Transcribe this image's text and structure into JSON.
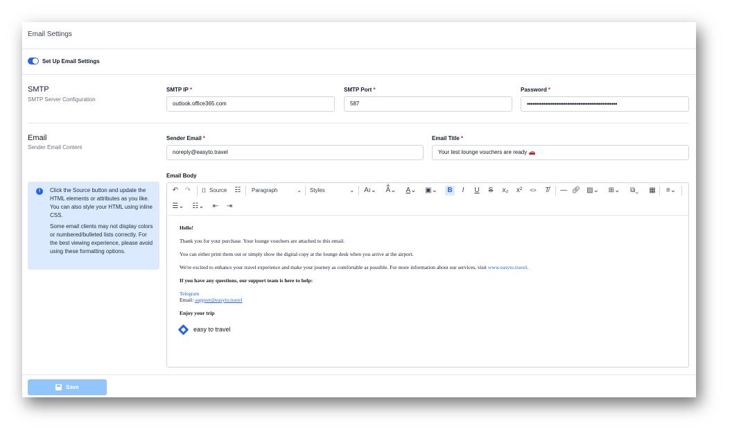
{
  "page": {
    "title": "Email Settings"
  },
  "toggle": {
    "label": "Set Up Email Settings",
    "enabled": true,
    "accent": "#2563eb"
  },
  "smtp": {
    "title": "SMTP",
    "subtitle": "SMTP Server Configuration",
    "ip_label": "SMTP IP",
    "ip_value": "outlook.office365.com",
    "port_label": "SMTP Port",
    "port_value": "587",
    "password_label": "Password",
    "password_value": "•••••••••••••••••••••••••••••••••••••••••••••••••"
  },
  "email": {
    "title": "Email",
    "subtitle": "Sender Email Content",
    "sender_label": "Sender Email",
    "sender_value": "noreply@easyto.travel",
    "title_label": "Email Title",
    "title_value": "Your test lounge vouchers are ready 🚗",
    "body_label": "Email Body"
  },
  "required_mark": "*",
  "info": {
    "icon": "!",
    "paragraph1": "Click the Source button and update the HTML elements or attributes as you like. You can also style your HTML using inline CSS.",
    "paragraph2": "Some email clients may not display colors or numbered/bulleted lists correctly. For the best viewing experience, please avoid using these formatting options."
  },
  "toolbar": {
    "source_label": "Source",
    "paragraph_label": "Paragraph",
    "styles_label": "Styles"
  },
  "body": {
    "greeting": "Hello!",
    "line1": "Thank you for your purchase. Your lounge vouchers are attached to this email.",
    "line2": "You can either print them out or simply show the digital copy at the lounge desk when you arrive at the airport.",
    "line3_text": "We're excited to enhance your travel experience and make your journey as comfortable as possible. For more information about our services, visit ",
    "line3_link": "www.easyto.travel",
    "line3_end": ".",
    "questions": "If you have any questions, our support team is here to help:",
    "telegram": "Telegram",
    "email_prefix": "Email: ",
    "email_link": "support@easyto.travel",
    "signoff": "Enjoy your trip",
    "logo_text": "easy to travel"
  },
  "footer": {
    "save_label": "Save"
  }
}
